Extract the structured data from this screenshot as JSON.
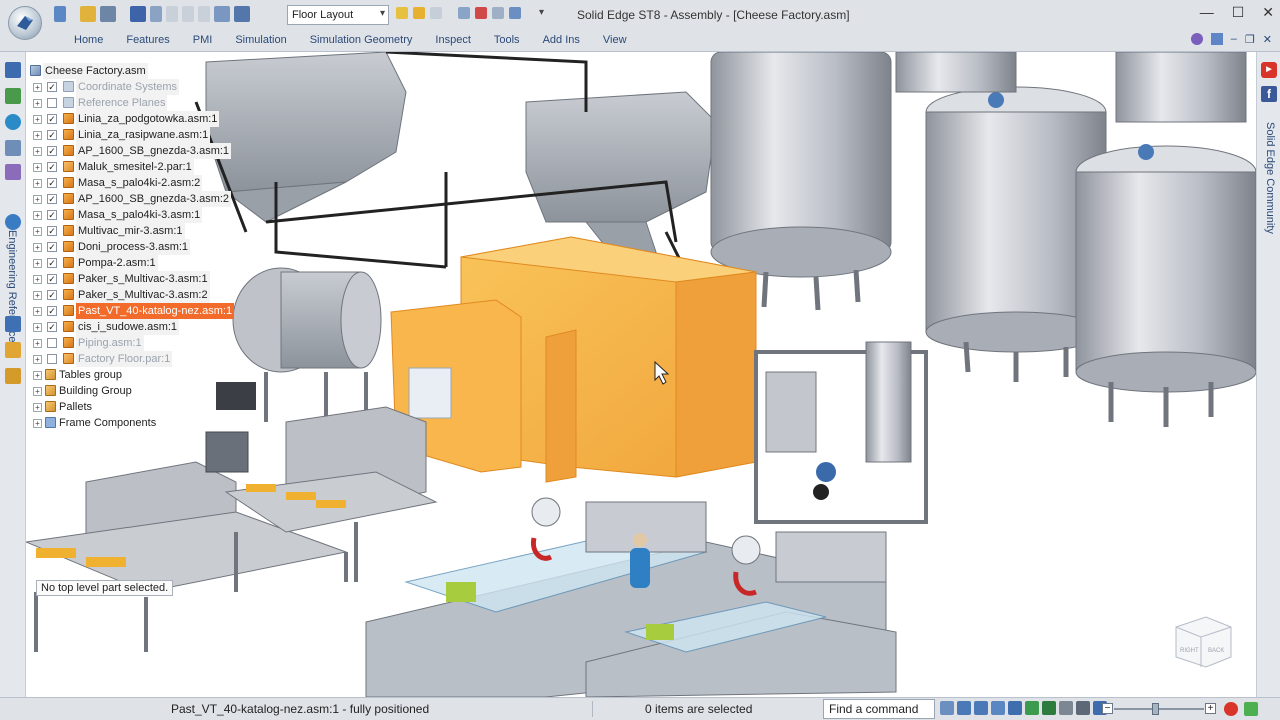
{
  "window": {
    "title": "Solid Edge ST8 - Assembly - [Cheese Factory.asm]",
    "layout_select": "Floor Layout",
    "minimize": "—",
    "maximize": "☐",
    "close": "✕"
  },
  "ribbon": {
    "tabs": [
      "Home",
      "Features",
      "PMI",
      "Simulation",
      "Simulation Geometry",
      "Inspect",
      "Tools",
      "Add Ins",
      "View"
    ]
  },
  "sidebar": {
    "engineering_reference": "Engineering Reference"
  },
  "rightrail": {
    "community": "Solid Edge Community",
    "youtube": "You\nTube",
    "facebook": "f"
  },
  "tree": {
    "root": "Cheese Factory.asm",
    "items": [
      {
        "label": "Coordinate Systems",
        "style": "dim-hl",
        "icon": "coord",
        "checked": true
      },
      {
        "label": "Reference Planes",
        "style": "dim-hl",
        "icon": "plane",
        "checked": false
      },
      {
        "label": "Linia_za_podgotowka.asm:1",
        "style": "hl",
        "icon": "asm",
        "checked": true
      },
      {
        "label": "Linia_za_rasipwane.asm:1",
        "style": "hl",
        "icon": "asm",
        "checked": true
      },
      {
        "label": "AP_1600_SB_gnezda-3.asm:1",
        "style": "hl",
        "icon": "asm",
        "checked": true
      },
      {
        "label": "Maluk_smesitel-2.par:1",
        "style": "hl",
        "icon": "par",
        "checked": true
      },
      {
        "label": "Masa_s_palo4ki-2.asm:2",
        "style": "hl",
        "icon": "asm",
        "checked": true
      },
      {
        "label": "AP_1600_SB_gnezda-3.asm:2",
        "style": "hl",
        "icon": "asm",
        "checked": true
      },
      {
        "label": "Masa_s_palo4ki-3.asm:1",
        "style": "hl",
        "icon": "asm",
        "checked": true
      },
      {
        "label": "Multivac_mir-3.asm:1",
        "style": "hl",
        "icon": "asm",
        "checked": true
      },
      {
        "label": "Doni_process-3.asm:1",
        "style": "hl",
        "icon": "asm",
        "checked": true
      },
      {
        "label": "Pompa-2.asm:1",
        "style": "hl",
        "icon": "asm",
        "checked": true
      },
      {
        "label": "Paker_s_Multivac-3.asm:1",
        "style": "hl",
        "icon": "asm",
        "checked": true
      },
      {
        "label": "Paker_s_Multivac-3.asm:2",
        "style": "hl",
        "icon": "asm",
        "checked": true
      },
      {
        "label": "Past_VT_40-katalog-nez.asm:1",
        "style": "sel",
        "icon": "asm",
        "checked": true
      },
      {
        "label": "cis_i_sudowe.asm:1",
        "style": "hl",
        "icon": "asm",
        "checked": true
      },
      {
        "label": "Piping.asm:1",
        "style": "dim-hl",
        "icon": "asm",
        "checked": false
      },
      {
        "label": "Factory Floor.par:1",
        "style": "dim-hl",
        "icon": "par",
        "checked": false
      }
    ],
    "groups": [
      "Tables group",
      "Building Group",
      "Pallets",
      "Frame Components"
    ]
  },
  "tooltip": "No top level part selected.",
  "viewcube": {
    "right": "RIGHT",
    "back": "BACK"
  },
  "status": {
    "message": "Past_VT_40-katalog-nez.asm:1 - fully positioned",
    "selection": "0 items are selected",
    "find_command": "Find a command"
  },
  "colors": {
    "selection": "#f26b2a",
    "highlighted_component": "#f5b042",
    "ribbon_bg": "#dfe3e8"
  }
}
